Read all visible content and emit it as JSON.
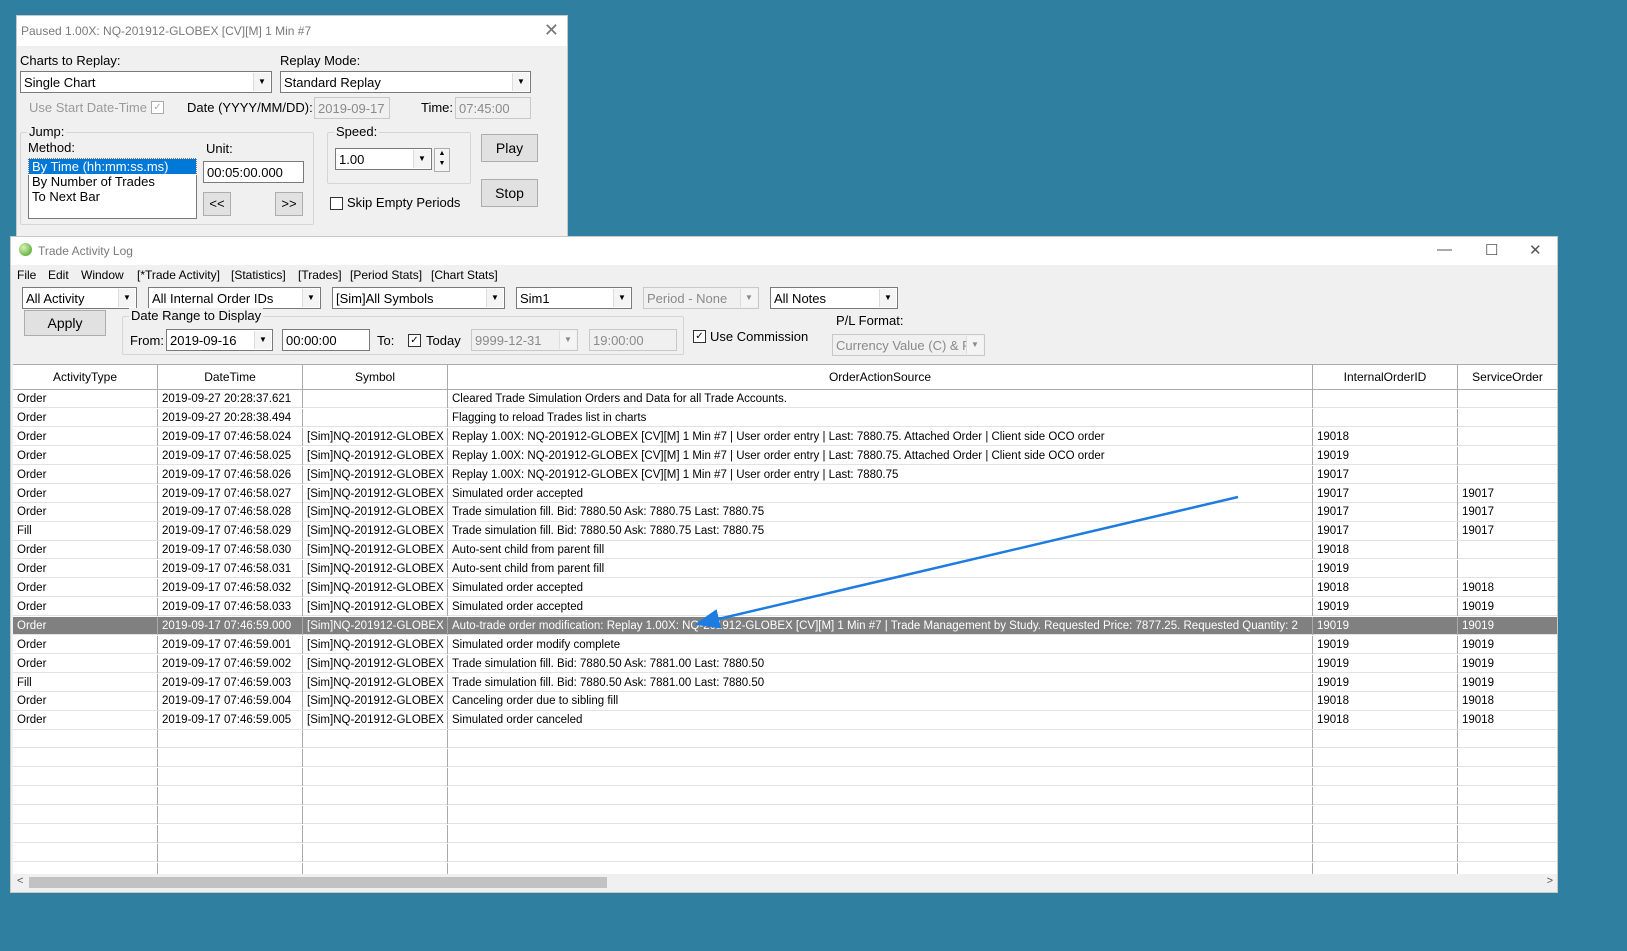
{
  "replay_window": {
    "title": "Paused 1.00X: NQ-201912-GLOBEX [CV][M]  1 Min   #7",
    "charts_to_replay_label": "Charts to Replay:",
    "charts_to_replay_value": "Single Chart",
    "replay_mode_label": "Replay Mode:",
    "replay_mode_value": "Standard Replay",
    "use_start_datetime_label": "Use Start Date-Time",
    "date_label": "Date (YYYY/MM/DD):",
    "date_value": "2019-09-17",
    "time_label": "Time:",
    "time_value": "07:45:00",
    "jump_label": "Jump:",
    "method_label": "Method:",
    "methods": [
      "By Time (hh:mm:ss.ms)",
      "By Number of Trades",
      "To Next Bar"
    ],
    "unit_label": "Unit:",
    "unit_value": "00:05:00.000",
    "back_label": "<<",
    "fwd_label": ">>",
    "speed_label": "Speed:",
    "speed_value": "1.00",
    "skip_empty_label": "Skip Empty Periods",
    "play_label": "Play",
    "stop_label": "Stop"
  },
  "log_window": {
    "title": "Trade Activity Log",
    "menu": [
      "File",
      "Edit",
      "Window",
      "[*Trade Activity]",
      "[Statistics]",
      "[Trades]",
      "[Period Stats]",
      "[Chart Stats]"
    ],
    "filters": {
      "activity": "All Activity",
      "order_ids": "All Internal Order IDs",
      "symbols": "[Sim]All Symbols",
      "account": "Sim1",
      "period": "Period - None",
      "notes": "All Notes"
    },
    "apply_label": "Apply",
    "date_range_label": "Date Range to Display",
    "from_label": "From:",
    "from_date": "2019-09-16",
    "from_time": "00:00:00",
    "to_label": "To:",
    "today_label": "Today",
    "to_date": "9999-12-31",
    "to_time": "19:00:00",
    "use_commission_label": "Use Commission",
    "pl_format_label": "P/L Format:",
    "pl_format_value": "Currency Value (C) & P",
    "columns": [
      "ActivityType",
      "DateTime",
      "Symbol",
      "OrderActionSource",
      "InternalOrderID",
      "ServiceOrder"
    ],
    "rows": [
      [
        "Order",
        "2019-09-27  20:28:37.621",
        "",
        "Cleared Trade Simulation Orders and Data for all Trade Accounts.",
        "",
        ""
      ],
      [
        "Order",
        "2019-09-27  20:28:38.494",
        "",
        "Flagging to reload Trades list in charts",
        "",
        ""
      ],
      [
        "Order",
        "2019-09-17  07:46:58.024",
        "[Sim]NQ-201912-GLOBEX",
        "Replay 1.00X: NQ-201912-GLOBEX [CV][M]  1 Min   #7 | User order entry | Last: 7880.75. Attached Order | Client side OCO order",
        "19018",
        ""
      ],
      [
        "Order",
        "2019-09-17  07:46:58.025",
        "[Sim]NQ-201912-GLOBEX",
        "Replay 1.00X: NQ-201912-GLOBEX [CV][M]  1 Min   #7 | User order entry | Last: 7880.75. Attached Order | Client side OCO order",
        "19019",
        ""
      ],
      [
        "Order",
        "2019-09-17  07:46:58.026",
        "[Sim]NQ-201912-GLOBEX",
        "Replay 1.00X: NQ-201912-GLOBEX [CV][M]  1 Min   #7 | User order entry | Last: 7880.75",
        "19017",
        ""
      ],
      [
        "Order",
        "2019-09-17  07:46:58.027",
        "[Sim]NQ-201912-GLOBEX",
        "Simulated order accepted",
        "19017",
        "19017"
      ],
      [
        "Order",
        "2019-09-17  07:46:58.028",
        "[Sim]NQ-201912-GLOBEX",
        "Trade simulation fill. Bid: 7880.50 Ask: 7880.75 Last: 7880.75",
        "19017",
        "19017"
      ],
      [
        "Fill",
        "2019-09-17  07:46:58.029",
        "[Sim]NQ-201912-GLOBEX",
        "Trade simulation fill. Bid: 7880.50 Ask: 7880.75 Last: 7880.75",
        "19017",
        "19017"
      ],
      [
        "Order",
        "2019-09-17  07:46:58.030",
        "[Sim]NQ-201912-GLOBEX",
        "Auto-sent child from parent fill",
        "19018",
        ""
      ],
      [
        "Order",
        "2019-09-17  07:46:58.031",
        "[Sim]NQ-201912-GLOBEX",
        "Auto-sent child from parent fill",
        "19019",
        ""
      ],
      [
        "Order",
        "2019-09-17  07:46:58.032",
        "[Sim]NQ-201912-GLOBEX",
        "Simulated order accepted",
        "19018",
        "19018"
      ],
      [
        "Order",
        "2019-09-17  07:46:58.033",
        "[Sim]NQ-201912-GLOBEX",
        "Simulated order accepted",
        "19019",
        "19019"
      ],
      [
        "Order",
        "2019-09-17  07:46:59.000",
        "[Sim]NQ-201912-GLOBEX",
        "Auto-trade order modification: Replay 1.00X: NQ-201912-GLOBEX [CV][M]  1 Min   #7 | Trade Management by Study. Requested Price: 7877.25. Requested Quantity: 2",
        "19019",
        "19019"
      ],
      [
        "Order",
        "2019-09-17  07:46:59.001",
        "[Sim]NQ-201912-GLOBEX",
        "Simulated order modify complete",
        "19019",
        "19019"
      ],
      [
        "Order",
        "2019-09-17  07:46:59.002",
        "[Sim]NQ-201912-GLOBEX",
        "Trade simulation fill. Bid: 7880.50 Ask: 7881.00 Last: 7880.50",
        "19019",
        "19019"
      ],
      [
        "Fill",
        "2019-09-17  07:46:59.003",
        "[Sim]NQ-201912-GLOBEX",
        "Trade simulation fill. Bid: 7880.50 Ask: 7881.00 Last: 7880.50",
        "19019",
        "19019"
      ],
      [
        "Order",
        "2019-09-17  07:46:59.004",
        "[Sim]NQ-201912-GLOBEX",
        "Canceling order due to sibling fill",
        "19018",
        "19018"
      ],
      [
        "Order",
        "2019-09-17  07:46:59.005",
        "[Sim]NQ-201912-GLOBEX",
        "Simulated order canceled",
        "19018",
        "19018"
      ]
    ],
    "highlighted_row": 12
  },
  "colors": {
    "desktop": "#2f7fa0",
    "selection": "#0078d7",
    "highlight_row": "#808080",
    "annotation_arrow": "#1e7be0"
  }
}
